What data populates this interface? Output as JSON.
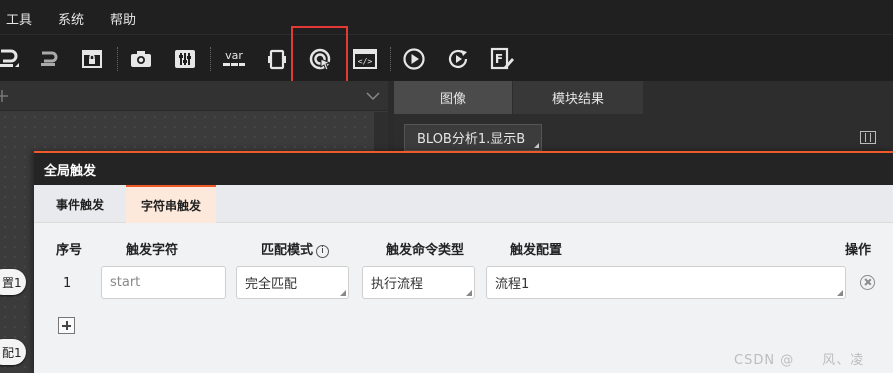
{
  "menu": {
    "tools": "工具",
    "system": "系统",
    "help": "帮助"
  },
  "toolbar": {
    "icons": [
      "undo-icon",
      "redo-icon",
      "lock-window-icon",
      "camera-icon",
      "sliders-icon",
      "variable-icon",
      "device-icon",
      "target-cursor-icon",
      "script-icon",
      "run-icon",
      "cycle-run-icon",
      "edit-doc-icon"
    ],
    "var_label": "var"
  },
  "right_panel": {
    "tabs": [
      "图像",
      "模块结果"
    ],
    "image_source": "BLOB分析1.显示B"
  },
  "canvas_nodes": [
    "置1",
    "配1"
  ],
  "dialog": {
    "title": "全局触发",
    "tabs": [
      "事件触发",
      "字符串触发"
    ],
    "active_tab": "字符串触发",
    "columns": {
      "index": "序号",
      "trigger_string": "触发字符",
      "match_mode": "匹配模式",
      "command_type": "触发命令类型",
      "config": "触发配置",
      "action": "操作"
    },
    "rows": [
      {
        "index": "1",
        "trigger_string_placeholder": "start",
        "match_mode": "完全匹配",
        "command_type": "执行流程",
        "config": "流程1"
      }
    ]
  },
  "watermark": "CSDN @　　风、凌",
  "colors": {
    "accent": "#f05a28",
    "highlight": "#e53935",
    "dark_bg": "#202020"
  }
}
